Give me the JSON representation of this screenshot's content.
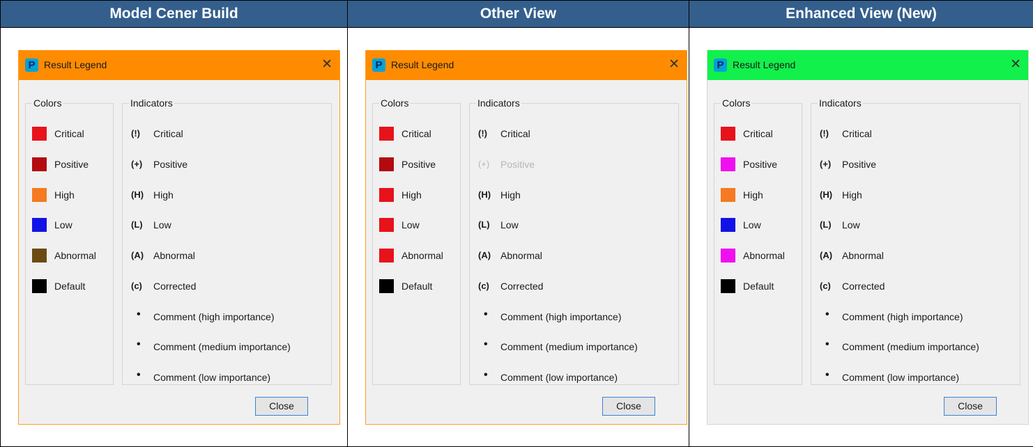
{
  "headers": [
    "Model Cener Build",
    "Other View",
    "Enhanced View (New)"
  ],
  "dialog": {
    "icon_letter": "P",
    "title": "Result Legend",
    "close_glyph": "✕",
    "colors_group_label": "Colors",
    "indicators_group_label": "Indicators",
    "close_button": "Close"
  },
  "panels": [
    {
      "titlebar_color": "#ff8c00",
      "colors": [
        {
          "label": "Critical",
          "swatch": "#e8121b"
        },
        {
          "label": "Positive",
          "swatch": "#b30a10"
        },
        {
          "label": "High",
          "swatch": "#f57a22"
        },
        {
          "label": "Low",
          "swatch": "#1212e6"
        },
        {
          "label": "Abnormal",
          "swatch": "#6b4a12"
        },
        {
          "label": "Default",
          "swatch": "#000000"
        }
      ],
      "indicators": [
        {
          "symbol": "(!)",
          "label": "Critical",
          "dimmed": false
        },
        {
          "symbol": "(+)",
          "label": "Positive",
          "dimmed": false
        },
        {
          "symbol": "(H)",
          "label": "High",
          "dimmed": false
        },
        {
          "symbol": "(L)",
          "label": "Low",
          "dimmed": false
        },
        {
          "symbol": "(A)",
          "label": "Abnormal",
          "dimmed": false
        },
        {
          "symbol": "(c)",
          "label": "Corrected",
          "dimmed": false
        },
        {
          "symbol": "•",
          "label": "Comment (high importance)",
          "dimmed": false
        },
        {
          "symbol": "•",
          "label": "Comment (medium importance)",
          "dimmed": false
        },
        {
          "symbol": "•",
          "label": "Comment (low importance)",
          "dimmed": false
        }
      ]
    },
    {
      "titlebar_color": "#ff8c00",
      "colors": [
        {
          "label": "Critical",
          "swatch": "#e8121b"
        },
        {
          "label": "Positive",
          "swatch": "#b30a10"
        },
        {
          "label": "High",
          "swatch": "#e8121b"
        },
        {
          "label": "Low",
          "swatch": "#e8121b"
        },
        {
          "label": "Abnormal",
          "swatch": "#e8121b"
        },
        {
          "label": "Default",
          "swatch": "#000000"
        }
      ],
      "indicators": [
        {
          "symbol": "(!)",
          "label": "Critical",
          "dimmed": false
        },
        {
          "symbol": "(+)",
          "label": "Positive",
          "dimmed": true
        },
        {
          "symbol": "(H)",
          "label": "High",
          "dimmed": false
        },
        {
          "symbol": "(L)",
          "label": "Low",
          "dimmed": false
        },
        {
          "symbol": "(A)",
          "label": "Abnormal",
          "dimmed": false
        },
        {
          "symbol": "(c)",
          "label": "Corrected",
          "dimmed": false
        },
        {
          "symbol": "•",
          "label": "Comment (high importance)",
          "dimmed": false
        },
        {
          "symbol": "•",
          "label": "Comment (medium importance)",
          "dimmed": false
        },
        {
          "symbol": "•",
          "label": "Comment (low importance)",
          "dimmed": false
        }
      ]
    },
    {
      "titlebar_color": "#12f04c",
      "colors": [
        {
          "label": "Critical",
          "swatch": "#e8121b"
        },
        {
          "label": "Positive",
          "swatch": "#f00ff0"
        },
        {
          "label": "High",
          "swatch": "#f57a22"
        },
        {
          "label": "Low",
          "swatch": "#1212e6"
        },
        {
          "label": "Abnormal",
          "swatch": "#f00ff0"
        },
        {
          "label": "Default",
          "swatch": "#000000"
        }
      ],
      "indicators": [
        {
          "symbol": "(!)",
          "label": "Critical",
          "dimmed": false
        },
        {
          "symbol": "(+)",
          "label": "Positive",
          "dimmed": false
        },
        {
          "symbol": "(H)",
          "label": "High",
          "dimmed": false
        },
        {
          "symbol": "(L)",
          "label": "Low",
          "dimmed": false
        },
        {
          "symbol": "(A)",
          "label": "Abnormal",
          "dimmed": false
        },
        {
          "symbol": "(c)",
          "label": "Corrected",
          "dimmed": false
        },
        {
          "symbol": "•",
          "label": "Comment (high importance)",
          "dimmed": false
        },
        {
          "symbol": "•",
          "label": "Comment (medium importance)",
          "dimmed": false
        },
        {
          "symbol": "•",
          "label": "Comment (low importance)",
          "dimmed": false
        }
      ]
    }
  ]
}
